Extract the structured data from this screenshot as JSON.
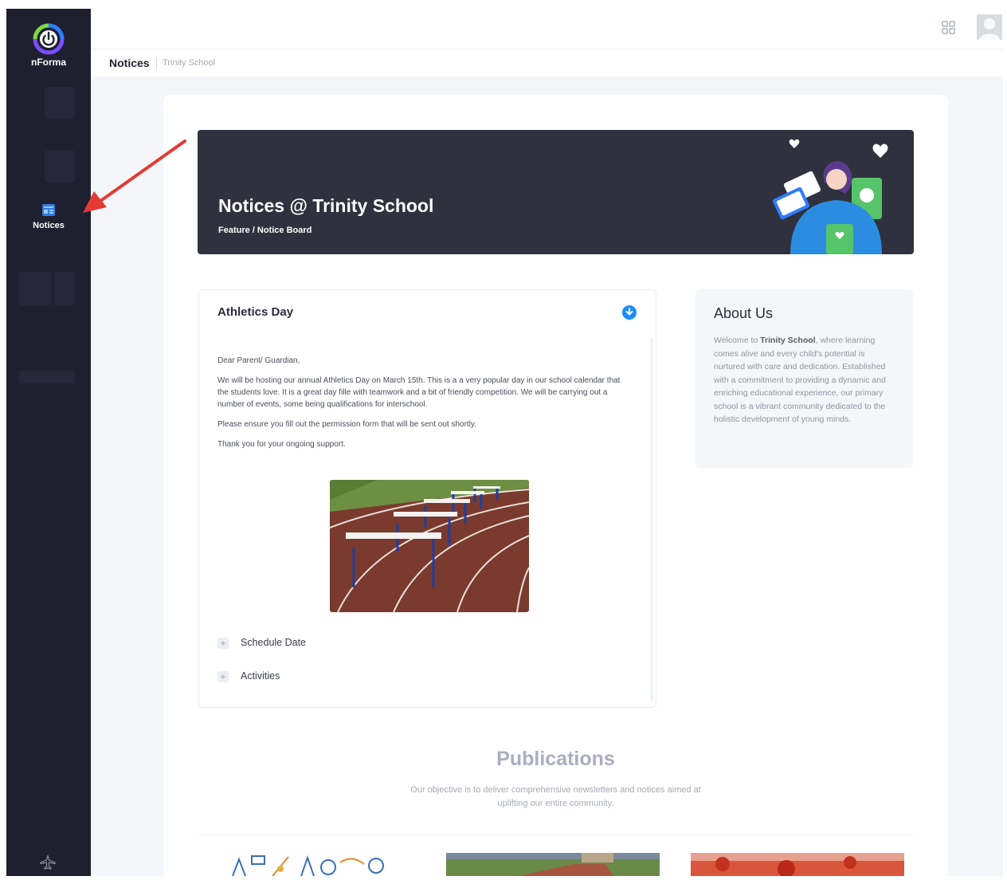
{
  "app": {
    "name": "nForma"
  },
  "sidebar": {
    "active_item": {
      "label": "Notices",
      "icon": "notice-board-icon"
    }
  },
  "breadcrumb": {
    "title": "Notices",
    "sub": "Trinity School"
  },
  "banner": {
    "title": "Notices @ Trinity School",
    "crumb": "Feature / Notice Board"
  },
  "notice": {
    "title": "Athletics Day",
    "greeting": "Dear Parent/ Guardian,",
    "paragraph1": "We will be hosting our annual Athletics Day on March 15th. This is a a very popular day in our school calendar that the students love. It is a great day fille with teamwork and a bit of friendly competition. We will be carrying out a number of events, some being qualifications for interschool.",
    "paragraph2": "Please ensure you fill out the permission form that will be sent out shortly.",
    "paragraph3": "Thank you for your ongoing support.",
    "sections": [
      "Schedule Date",
      "Activities"
    ]
  },
  "about": {
    "title": "About Us",
    "text_before": "Welcome to ",
    "school": "Trinity School",
    "text_after": ", where learning comes alive and every child's potential is nurtured with care and dedication. Established with a commitment to providing a dynamic and enriching educational experience, our primary school is a vibrant community dedicated to the holistic development of young minds."
  },
  "publications": {
    "title": "Publications",
    "subtitle": "Our objective is to deliver comprehensive newsletters and notices aimed at uplifting our entire community."
  },
  "colors": {
    "sidebar": "#1e2030",
    "banner": "#30313e",
    "accent": "#1a8cff",
    "annotation_arrow": "#e53935"
  }
}
